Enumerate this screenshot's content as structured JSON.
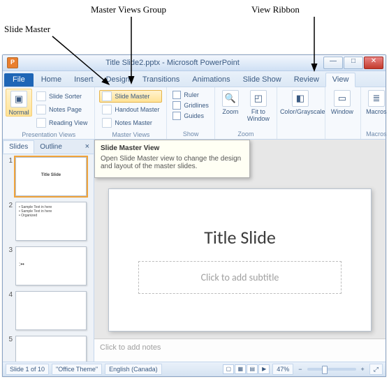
{
  "callouts": {
    "slide_master": "Slide Master",
    "master_views_group": "Master Views Group",
    "view_ribbon": "View Ribbon"
  },
  "window": {
    "title": "Title Slide2.pptx - Microsoft PowerPoint",
    "app_icon": "P"
  },
  "tabs": {
    "file": "File",
    "home": "Home",
    "insert": "Insert",
    "design": "Design",
    "transitions": "Transitions",
    "animations": "Animations",
    "slide_show": "Slide Show",
    "review": "Review",
    "view": "View"
  },
  "ribbon": {
    "presentation_views": {
      "label": "Presentation Views",
      "normal": "Normal",
      "slide_sorter": "Slide Sorter",
      "notes_page": "Notes Page",
      "reading_view": "Reading View"
    },
    "master_views": {
      "label": "Master Views",
      "slide_master": "Slide Master",
      "handout_master": "Handout Master",
      "notes_master": "Notes Master"
    },
    "show": {
      "label": "Show",
      "ruler": "Ruler",
      "gridlines": "Gridlines",
      "guides": "Guides"
    },
    "zoom": {
      "label": "Zoom",
      "zoom": "Zoom",
      "fit": "Fit to Window"
    },
    "color_grayscale": {
      "label": "Color/Grayscale"
    },
    "window_group": {
      "label": "Window"
    },
    "macros": {
      "label": "Macros",
      "btn": "Macros"
    }
  },
  "tooltip": {
    "title": "Slide Master View",
    "body": "Open Slide Master view to change the design and layout of the master slides."
  },
  "thumbs": {
    "tab_slides": "Slides",
    "tab_outline": "Outline",
    "close": "×",
    "items": [
      {
        "n": "1",
        "text": "Title Slide"
      },
      {
        "n": "2",
        "text": "• Sample Text in here\n• Sample Text in here\n• Organized"
      },
      {
        "n": "3",
        "text": ":••"
      },
      {
        "n": "4",
        "text": ""
      },
      {
        "n": "5",
        "text": ""
      }
    ]
  },
  "slide": {
    "title": "Title Slide",
    "subtitle_placeholder": "Click to add subtitle"
  },
  "notes": {
    "placeholder": "Click to add notes"
  },
  "status": {
    "slide_count": "Slide 1 of 10",
    "theme": "\"Office Theme\"",
    "language": "English (Canada)",
    "zoom": "47%"
  }
}
